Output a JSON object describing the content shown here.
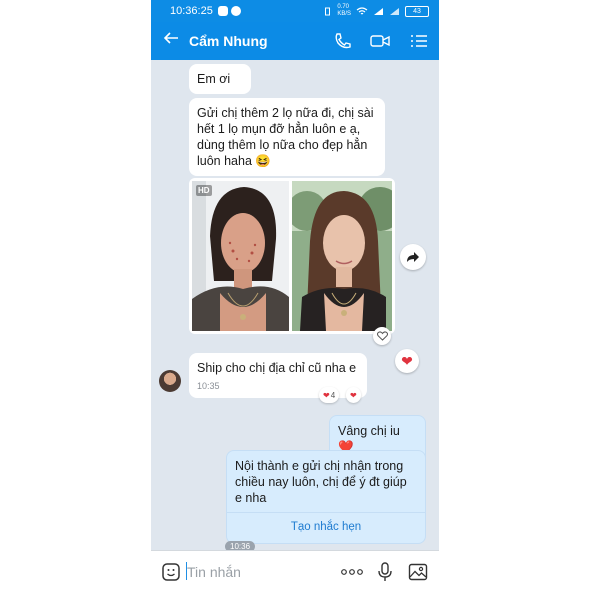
{
  "status_bar": {
    "time": "10:36:25",
    "network_speed": "0.70\nKB/S",
    "battery": "43"
  },
  "header": {
    "title": "Cẩm Nhung",
    "icons": [
      "back-arrow-icon",
      "phone-icon",
      "video-call-icon",
      "menu-list-icon"
    ]
  },
  "messages": {
    "m1": {
      "text": "Em ơi"
    },
    "m2": {
      "text": "Gửi chị thêm 2 lọ nữa đi, chị sài hết 1 lọ mụn đỡ hẳn luôn e ạ, dùng thêm lọ nữa cho đẹp hẳn luôn haha 😆"
    },
    "photo": {
      "badge": "HD"
    },
    "m3": {
      "text": "Ship cho chị địa chỉ cũ nha e",
      "time": "10:35",
      "reaction_count": "4"
    },
    "m4": {
      "text": "Vâng chị iu ❤️"
    },
    "m5": {
      "text": "Nội thành e gửi chị nhận trong chiều nay luôn, chị để ý đt giúp e nha",
      "action": "Tạo nhắc hẹn",
      "time": "10:36"
    }
  },
  "input": {
    "placeholder": "Tin nhắn",
    "icons": [
      "sticker-icon",
      "more-icon",
      "microphone-icon",
      "image-icon"
    ]
  },
  "colors": {
    "accent": "#0c8be6",
    "chat_background": "#dfe6ee",
    "outgoing_bubble": "#d7ecfd",
    "heart": "#e0333f"
  }
}
